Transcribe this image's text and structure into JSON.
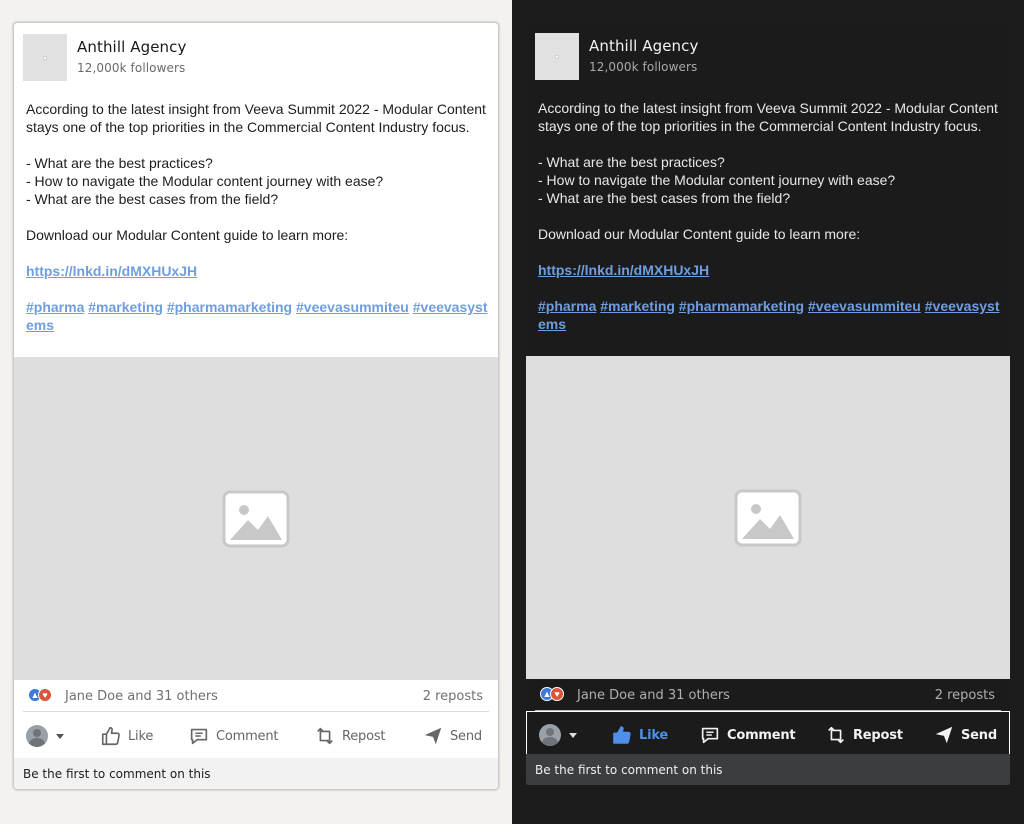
{
  "post": {
    "company_name": "Anthill Agency",
    "followers": "12,000k followers",
    "body_lines": [
      "According to the latest insight from Veeva Summit 2022 - Modular Content stays one of the top priorities in the Commercial Content Industry focus.",
      "",
      "- What are the best practices?",
      "- How to navigate the Modular content journey with ease?",
      "- What are the best cases from the field?",
      "",
      "Download our Modular Content guide to learn more:",
      ""
    ],
    "link": "https://lnkd.in/dMXHUxJH",
    "hashtags": [
      "#pharma",
      "#marketing",
      "#pharmamarketing",
      "#veevasummiteu",
      "#veevasystems"
    ],
    "reactions_text": "Jane Doe and 31 others",
    "reposts_text": "2 reposts",
    "actions": {
      "like": "Like",
      "comment": "Comment",
      "repost": "Repost",
      "send": "Send"
    },
    "footer_text": "Be the first to comment on this"
  },
  "colors": {
    "light_background": "#f3f2ef",
    "dark_background": "#1c1c1d",
    "link_color": "#6f9ee0",
    "like_active_dark": "#4f8fe8"
  },
  "icons": [
    "image-placeholder-icon",
    "like-icon",
    "comment-icon",
    "repost-icon",
    "send-icon",
    "caret-down-icon",
    "thumbs-up-reaction-icon",
    "heart-reaction-icon"
  ]
}
